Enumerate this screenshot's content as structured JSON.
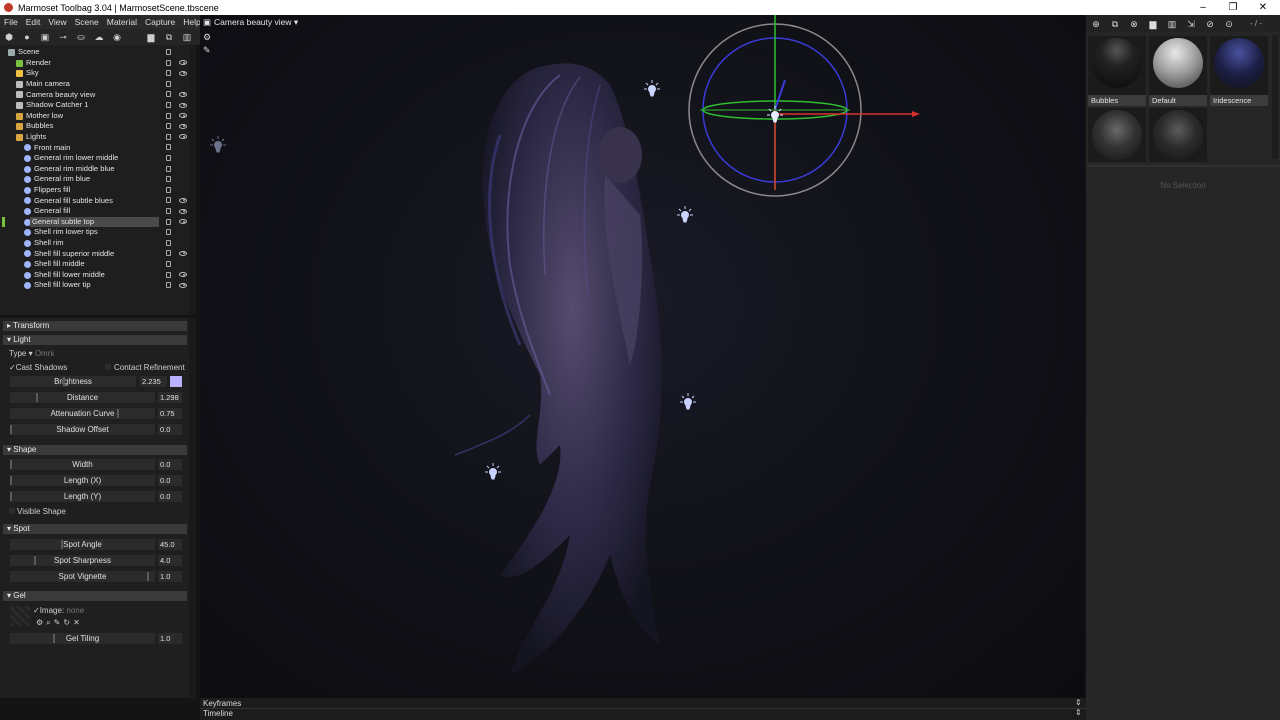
{
  "window": {
    "title": "Marmoset Toolbag 3.04  |  MarmosetScene.tbscene",
    "minimize": "–",
    "maximize": "❐",
    "close": "✕"
  },
  "menu": [
    "File",
    "Edit",
    "View",
    "Scene",
    "Material",
    "Capture",
    "Help"
  ],
  "scene_toolbar_icons": [
    "cube-icon",
    "light-icon",
    "camera-icon",
    "shadow-icon",
    "shell-icon",
    "sky-icon",
    "sphere-icon",
    "folder-icon",
    "duplicate-icon",
    "trash-icon"
  ],
  "outliner": {
    "items": [
      {
        "label": "Scene",
        "indent": 0,
        "icon": "scene-icon",
        "eye": false,
        "lock": true
      },
      {
        "label": "Render",
        "indent": 1,
        "icon": "render-icon",
        "eye": true,
        "lock": true
      },
      {
        "label": "Sky",
        "indent": 1,
        "icon": "sky-icon",
        "eye": true,
        "lock": true
      },
      {
        "label": "Main camera",
        "indent": 1,
        "icon": "camera-icon",
        "eye": false,
        "lock": true
      },
      {
        "label": "Camera beauty view",
        "indent": 1,
        "icon": "camera-icon",
        "eye": true,
        "lock": true
      },
      {
        "label": "Shadow Catcher 1",
        "indent": 1,
        "icon": "shadow-icon",
        "eye": true,
        "lock": true
      },
      {
        "label": "Mother low",
        "indent": 1,
        "icon": "mesh-icon",
        "eye": true,
        "lock": true
      },
      {
        "label": "Bubbles",
        "indent": 1,
        "icon": "mesh-icon",
        "eye": true,
        "lock": true
      },
      {
        "label": "Lights",
        "indent": 1,
        "icon": "folder-icon",
        "eye": true,
        "lock": true
      },
      {
        "label": "Front main",
        "indent": 2,
        "icon": "light-icon",
        "eye": false,
        "lock": true
      },
      {
        "label": "General rim lower middle",
        "indent": 2,
        "icon": "light-icon",
        "eye": false,
        "lock": true
      },
      {
        "label": "General rim middle blue",
        "indent": 2,
        "icon": "light-icon",
        "eye": false,
        "lock": true
      },
      {
        "label": "General rim blue",
        "indent": 2,
        "icon": "light-icon",
        "eye": false,
        "lock": true
      },
      {
        "label": "Flippers fill",
        "indent": 2,
        "icon": "light-icon",
        "eye": false,
        "lock": true
      },
      {
        "label": "General fill subtle blues",
        "indent": 2,
        "icon": "light-icon",
        "eye": true,
        "lock": true
      },
      {
        "label": "General fill",
        "indent": 2,
        "icon": "light-icon",
        "eye": true,
        "lock": true
      },
      {
        "label": "General subtle top",
        "indent": 2,
        "icon": "light-icon",
        "eye": true,
        "lock": true,
        "selected": true
      },
      {
        "label": "Shell rim lower tips",
        "indent": 2,
        "icon": "light-icon",
        "eye": false,
        "lock": true
      },
      {
        "label": "Shell rim",
        "indent": 2,
        "icon": "light-icon",
        "eye": false,
        "lock": true
      },
      {
        "label": "Shell fill superior middle",
        "indent": 2,
        "icon": "light-icon",
        "eye": true,
        "lock": true
      },
      {
        "label": "Shell fill middle",
        "indent": 2,
        "icon": "light-icon",
        "eye": false,
        "lock": true
      },
      {
        "label": "Shell fill lower middle",
        "indent": 2,
        "icon": "light-icon",
        "eye": true,
        "lock": true
      },
      {
        "label": "Shell fill lower tip",
        "indent": 2,
        "icon": "light-icon",
        "eye": true,
        "lock": true
      }
    ]
  },
  "properties": {
    "transform": {
      "label": "Transform",
      "collapsed": true
    },
    "light": {
      "label": "Light",
      "type_label": "Type",
      "type_value": "Omni",
      "cast_shadows": "Cast Shadows",
      "contact_refinement": "Contact Refinement",
      "sliders": [
        {
          "label": "Brightness",
          "value": "2.235",
          "fill": 0.37,
          "swatch": "#b9b3ff"
        },
        {
          "label": "Distance",
          "value": "1.298",
          "fill": 0.18
        },
        {
          "label": "Attenuation Curve",
          "value": "0.75",
          "fill": 0.75
        },
        {
          "label": "Shadow Offset",
          "value": "0.0",
          "fill": 0.0
        }
      ]
    },
    "shape": {
      "label": "Shape",
      "sliders": [
        {
          "label": "Width",
          "value": "0.0",
          "fill": 0.0
        },
        {
          "label": "Length (X)",
          "value": "0.0",
          "fill": 0.0
        },
        {
          "label": "Length (Y)",
          "value": "0.0",
          "fill": 0.0
        }
      ],
      "visible_shape": "Visible Shape"
    },
    "spot": {
      "label": "Spot",
      "sliders": [
        {
          "label": "Spot Angle",
          "value": "45.0",
          "fill": 0.36
        },
        {
          "label": "Spot Sharpness",
          "value": "4.0",
          "fill": 0.17
        },
        {
          "label": "Spot Vignette",
          "value": "1.0",
          "fill": 0.96
        }
      ]
    },
    "gel": {
      "label": "Gel",
      "image_label": "Image:",
      "image_value": "none",
      "tiling_label": "Gel Tiling",
      "tiling_value": "1.0",
      "tiling_fill": 0.3
    }
  },
  "viewport": {
    "camera": "Camera beauty view ▾"
  },
  "materials": {
    "counter": "- / -",
    "items": [
      {
        "name": "Bubbles"
      },
      {
        "name": "Default"
      },
      {
        "name": "Iridescence"
      },
      {
        "name": ""
      },
      {
        "name": ""
      }
    ],
    "no_selection": "No Selection"
  },
  "bottom": {
    "keyframes": "Keyframes",
    "timeline": "Timeline"
  }
}
